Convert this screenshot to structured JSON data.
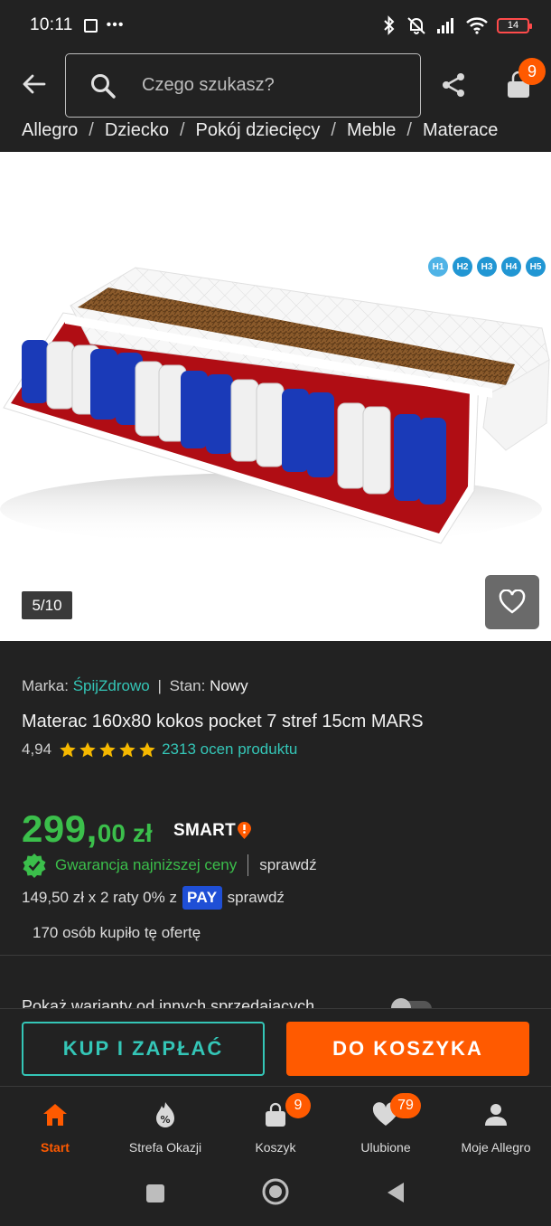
{
  "status_bar": {
    "time": "10:11",
    "battery": "14",
    "dots": "•••"
  },
  "header": {
    "search_placeholder": "Czego szukasz?",
    "cart_count": "9"
  },
  "breadcrumb": [
    "Allegro",
    "Dziecko",
    "Pokój dziecięcy",
    "Meble",
    "Materace"
  ],
  "gallery": {
    "counter": "5/10",
    "firmness_marks": [
      "H1",
      "H2",
      "H3",
      "H4",
      "H5"
    ]
  },
  "product": {
    "brand_label": "Marka:",
    "brand": "ŚpijZdrowo",
    "condition_label": "Stan:",
    "condition": "Nowy",
    "title": "Materac 160x80 kokos pocket 7 stref 15cm MARS",
    "rating": "4,94",
    "stars": 5,
    "rating_count": "2313 ocen produktu",
    "price_whole": "299,",
    "price_cents": "00",
    "currency": "zł",
    "smart_label": "SMART",
    "guarantee": "Gwarancja najniższej ceny",
    "check_link": "sprawdź",
    "installments": "149,50 zł x 2 raty 0% z",
    "pay_badge": "PAY",
    "installments_link": "sprawdź",
    "bought": "170 osób kupiło tę ofertę",
    "variants": "Pokaż warianty od innych sprzedających"
  },
  "actions": {
    "buy_now": "KUP I ZAPŁAĆ",
    "add_to_cart": "DO KOSZYKA"
  },
  "bottom_nav": [
    {
      "label": "Start",
      "badge": ""
    },
    {
      "label": "Strefa Okazji",
      "badge": ""
    },
    {
      "label": "Koszyk",
      "badge": "9"
    },
    {
      "label": "Ulubione",
      "badge": "79"
    },
    {
      "label": "Moje Allegro",
      "badge": ""
    }
  ],
  "colors": {
    "background": "#222222",
    "accent_orange": "#ff5a00",
    "teal": "#34c6b7",
    "price_green": "#3bbf4b",
    "star_yellow": "#f5b800",
    "pay_blue": "#1f4fd6"
  }
}
